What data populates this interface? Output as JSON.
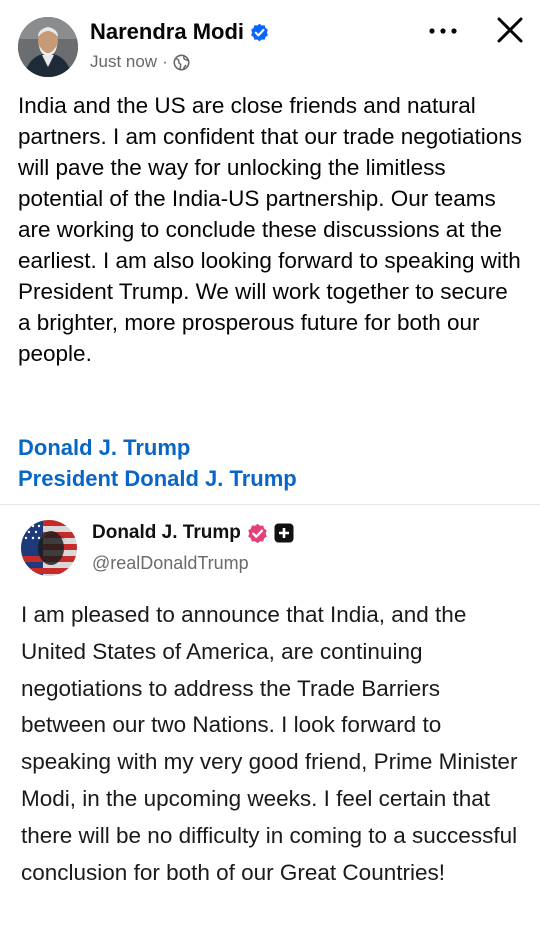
{
  "post": {
    "author": "Narendra Modi",
    "timestamp": "Just now",
    "separator": "·",
    "privacy_icon": "globe-icon",
    "text": "India and the US are close friends and natural partners. I am confident that our trade negotiations will pave the way for unlocking the limitless potential of the India-US partnership. Our teams are working to conclude these discussions at the earliest. I am also looking forward to speaking with President Trump. We will work together to secure a brighter, more prosperous future for both our people.",
    "tags": [
      "Donald J. Trump",
      "President Donald J. Trump"
    ]
  },
  "embedded": {
    "author": "Donald J. Trump",
    "handle": "@realDonaldTrump",
    "text": "I am pleased to announce that India, and the United States of America, are continuing negotiations to address the Trade Barriers between our two Nations. I look forward to speaking with my very good friend, Prime Minister Modi, in the upcoming weeks. I feel certain that there will be no difficulty in coming to a successful conclusion for both of our Great Countries!"
  },
  "colors": {
    "verified_blue": "#0866ff",
    "link_blue": "#0866c6",
    "truth_badge_pink": "#e2417c"
  }
}
